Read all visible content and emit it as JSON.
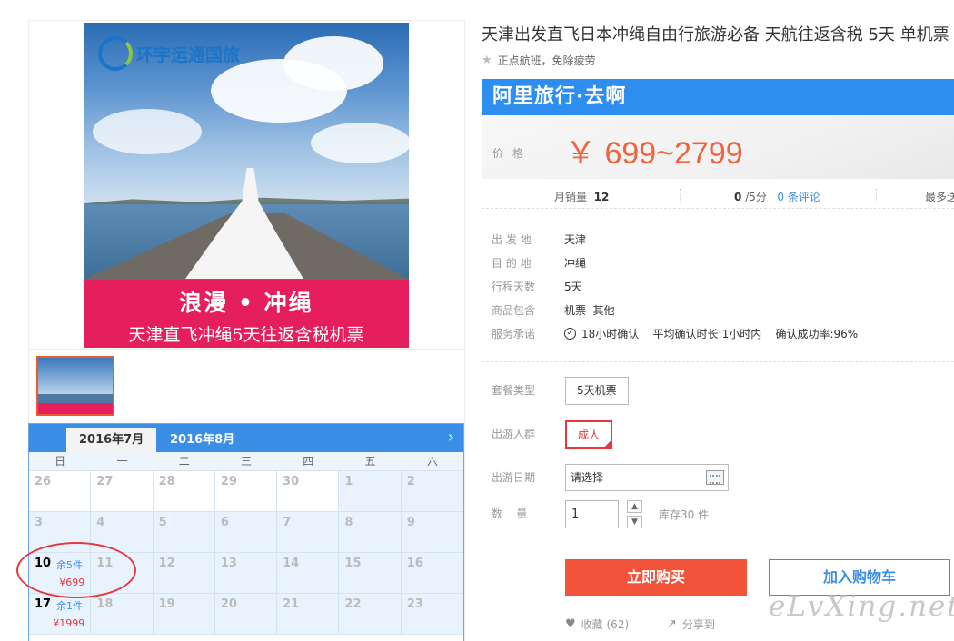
{
  "product": {
    "title": "天津出发直飞日本冲绳自由行旅游必备 天航往返含税 5天 单机票",
    "subtitle": "正点航班，免除疲劳",
    "promo": "阿里旅行·去啊",
    "price_label": "价格",
    "price": "￥ 699~2799",
    "image_logo": "环宇运通国旅",
    "image_banner_line1": "浪漫 • 冲绳",
    "image_banner_line2": "天津直飞冲绳5天往返含税机票"
  },
  "stats": {
    "sales_label": "月销量",
    "sales_value": "12",
    "rating_value": "0",
    "rating_suffix": "/5分",
    "reviews": "0 条评论",
    "more": "最多送"
  },
  "info": [
    {
      "k": "出 发 地",
      "v": "天津"
    },
    {
      "k": "目 的 地",
      "v": "冲绳"
    },
    {
      "k": "行程天数",
      "v": "5天"
    },
    {
      "k": "商品包含",
      "v": "机票  其他"
    },
    {
      "k": "服务承诺",
      "v": "18小时确认    平均确认时长:1小时内    确认成功率:96%"
    }
  ],
  "options": {
    "package_label": "套餐类型",
    "package_value": "5天机票",
    "people_label": "出游人群",
    "people_value": "成人",
    "date_label": "出游日期",
    "date_placeholder": "请选择",
    "qty_label": "数    量",
    "qty_value": "1",
    "stock": "库存30 件"
  },
  "actions": {
    "buy": "立即购买",
    "cart": "加入购物车",
    "favorite": "收藏",
    "favorite_count": "(62)",
    "share": "分享到"
  },
  "calendar": {
    "tab_active": "2016年7月",
    "tab_next": "2016年8月",
    "weekdays": [
      "日",
      "一",
      "二",
      "三",
      "四",
      "五",
      "六"
    ],
    "cells": [
      {
        "d": "26",
        "prev": true
      },
      {
        "d": "27",
        "prev": true
      },
      {
        "d": "28",
        "prev": true
      },
      {
        "d": "29",
        "prev": true
      },
      {
        "d": "30",
        "prev": true
      },
      {
        "d": "1"
      },
      {
        "d": "2"
      },
      {
        "d": "3"
      },
      {
        "d": "4"
      },
      {
        "d": "5"
      },
      {
        "d": "6"
      },
      {
        "d": "7"
      },
      {
        "d": "8"
      },
      {
        "d": "9"
      },
      {
        "d": "10",
        "stock": "余5件",
        "price": "¥699"
      },
      {
        "d": "11"
      },
      {
        "d": "12"
      },
      {
        "d": "13"
      },
      {
        "d": "14"
      },
      {
        "d": "15"
      },
      {
        "d": "16"
      },
      {
        "d": "17",
        "stock": "余1件",
        "price": "¥1999"
      },
      {
        "d": "18"
      },
      {
        "d": "19"
      },
      {
        "d": "20"
      },
      {
        "d": "21"
      },
      {
        "d": "22"
      },
      {
        "d": "23"
      }
    ]
  },
  "watermark": "eLvXing.net",
  "colors": {
    "accent": "#f2543b",
    "blue": "#2d8ef0",
    "price": "#f1643b"
  }
}
